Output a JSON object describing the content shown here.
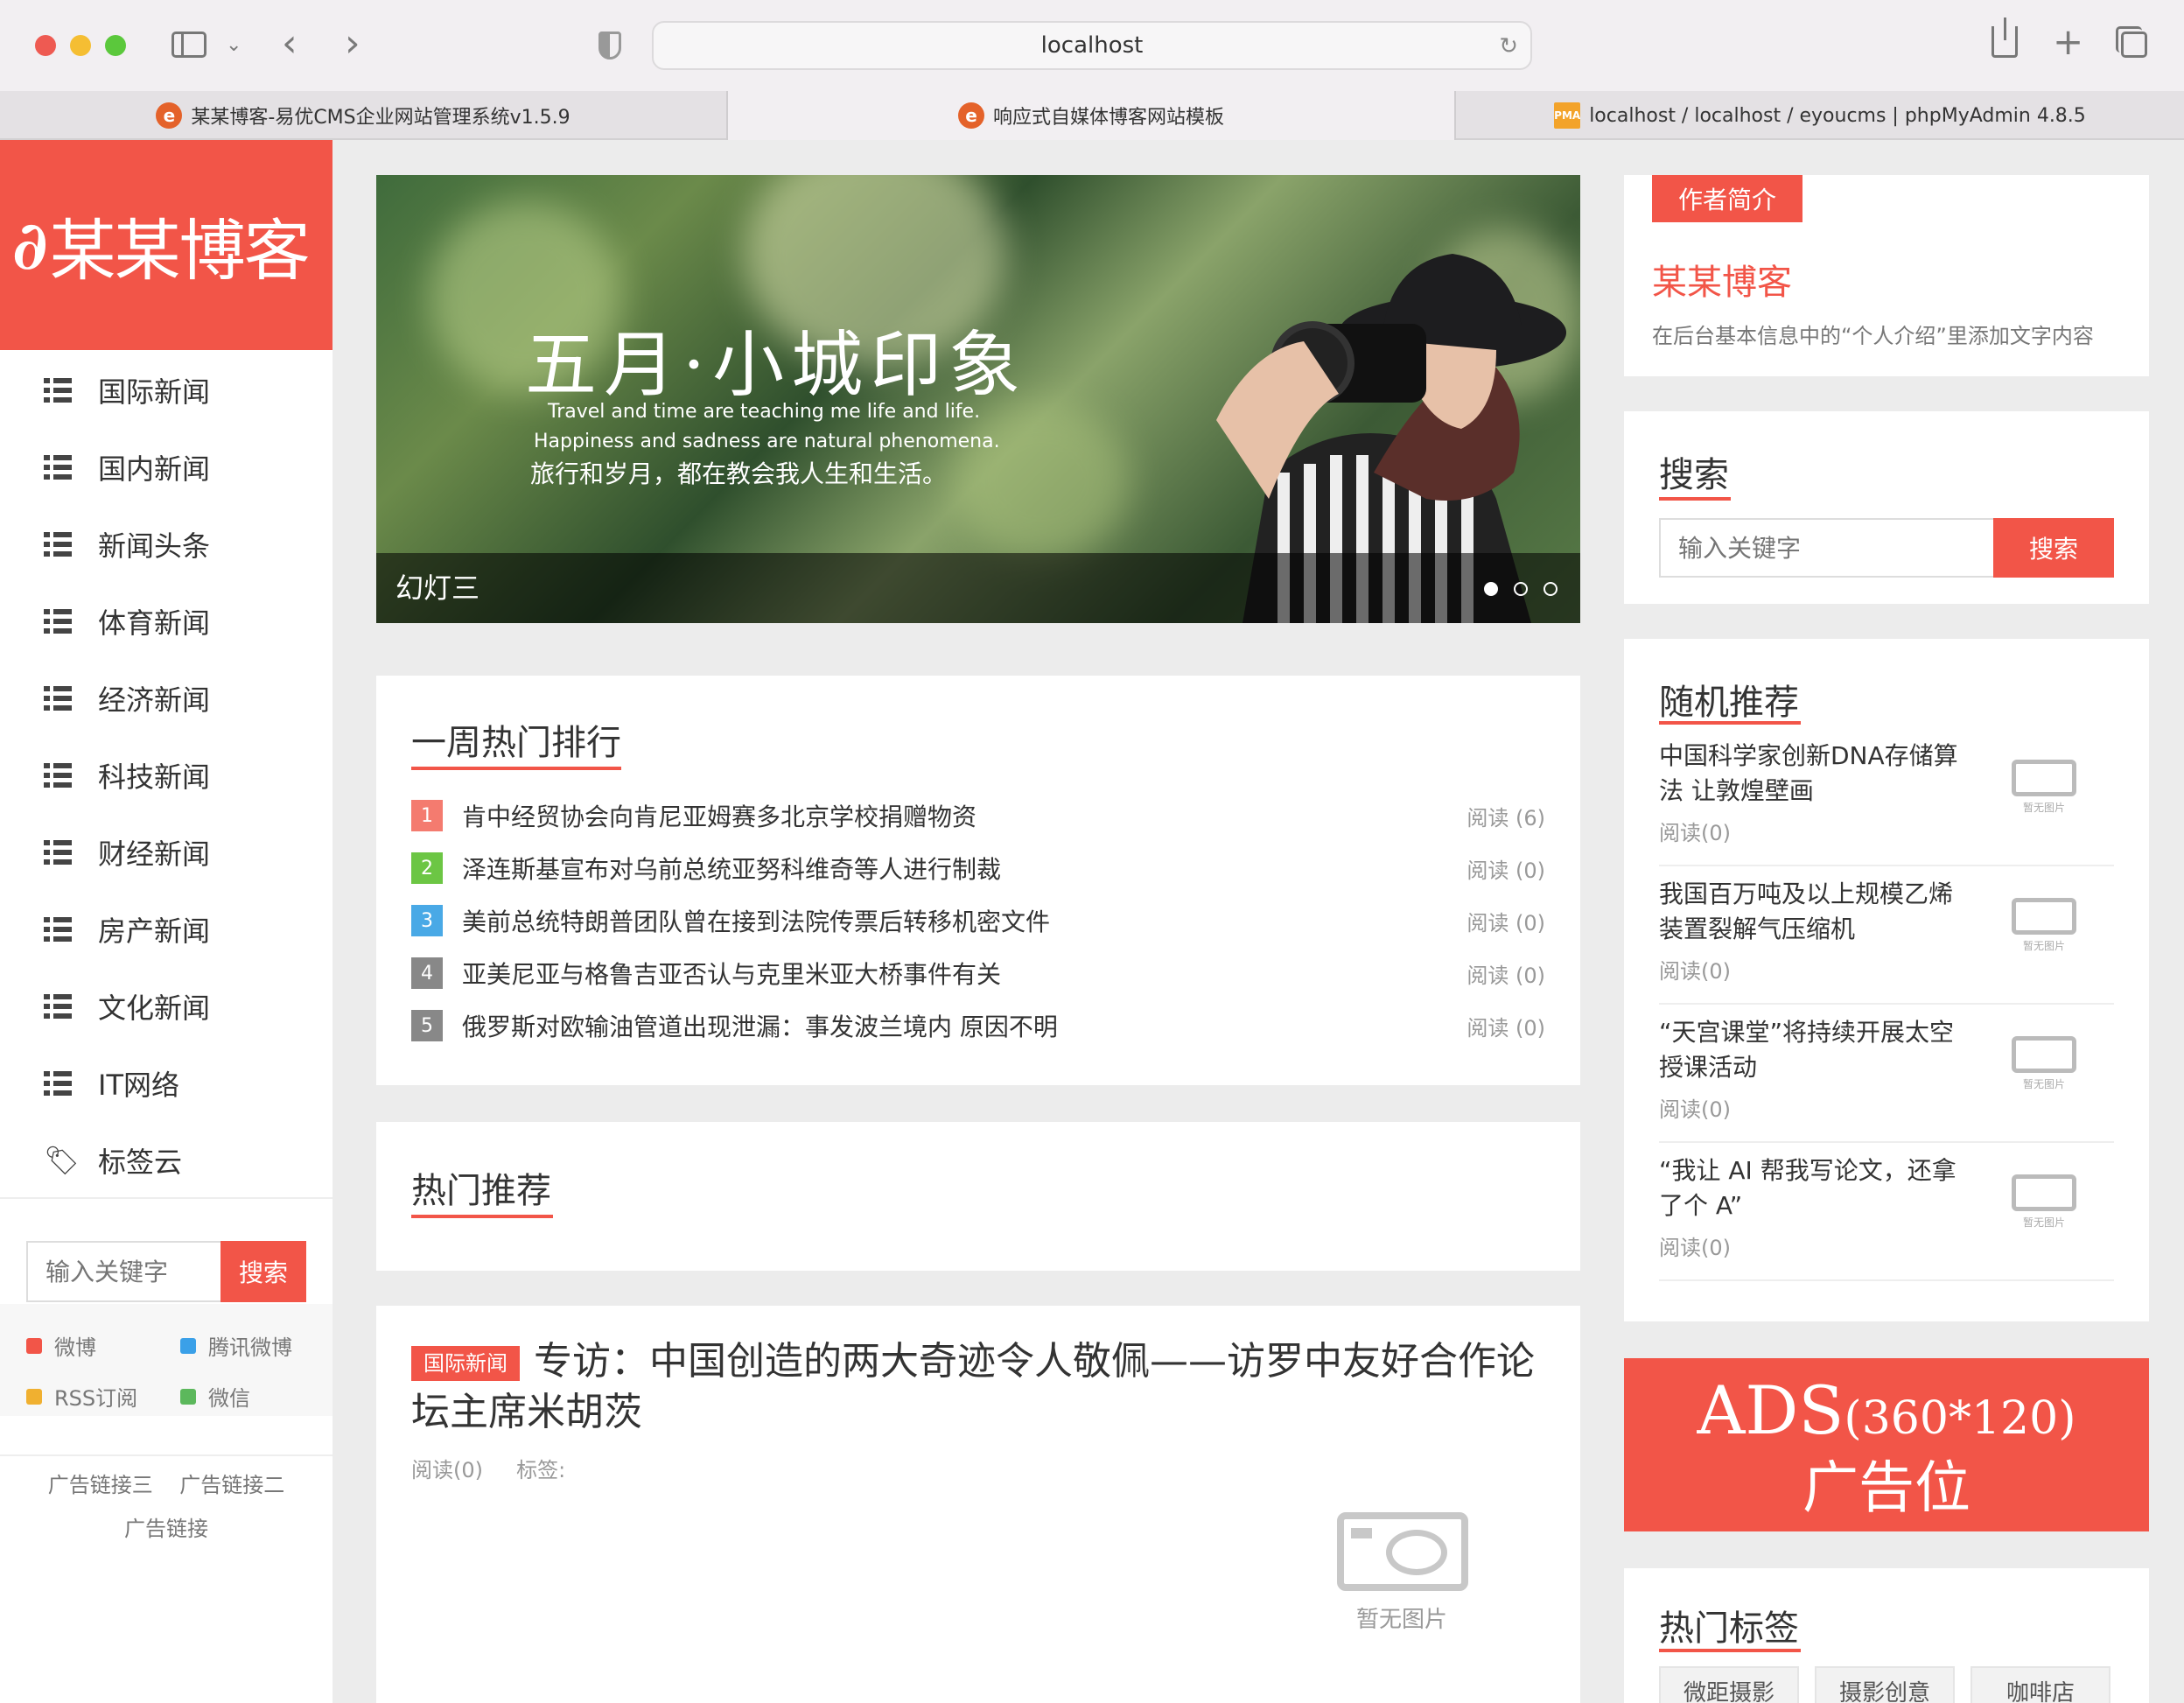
{
  "browser": {
    "address": "localhost",
    "tabs": [
      {
        "label": "某某博客-易优CMS企业网站管理系统v1.5.9"
      },
      {
        "label": "响应式自媒体博客网站模板"
      },
      {
        "label": "localhost / localhost / eyoucms | phpMyAdmin 4.8.5"
      }
    ]
  },
  "sidebar": {
    "logo_text": "某某博客",
    "nav": [
      {
        "label": "国际新闻"
      },
      {
        "label": "国内新闻"
      },
      {
        "label": "新闻头条"
      },
      {
        "label": "体育新闻"
      },
      {
        "label": "经济新闻"
      },
      {
        "label": "科技新闻"
      },
      {
        "label": "财经新闻"
      },
      {
        "label": "房产新闻"
      },
      {
        "label": "文化新闻"
      },
      {
        "label": "IT网络"
      },
      {
        "label": "标签云"
      }
    ],
    "search": {
      "placeholder": "输入关键字",
      "button": "搜索"
    },
    "social": [
      {
        "label": "微博",
        "color": "#f25548"
      },
      {
        "label": "腾讯微博",
        "color": "#3aa0e8"
      },
      {
        "label": "RSS订阅",
        "color": "#f0b030"
      },
      {
        "label": "微信",
        "color": "#5cb85c"
      }
    ],
    "ad_links": [
      "广告链接三",
      "广告链接二",
      "广告链接"
    ]
  },
  "slider": {
    "title_line": "五月·小城印象",
    "en_line1": "Travel and time are teaching me life and life.",
    "en_line2": "Happiness and sadness are natural phenomena.",
    "cn_line": "旅行和岁月，都在教会我人生和生活。",
    "caption": "幻灯三",
    "dots_total": 3,
    "active_dot": 1
  },
  "hot_week": {
    "title": "一周热门排行",
    "items": [
      {
        "num": "1",
        "title": "肯中经贸协会向肯尼亚姆赛多北京学校捐赠物资",
        "read": "阅读 (6)",
        "color": "#f47b6f"
      },
      {
        "num": "2",
        "title": "泽连斯基宣布对乌前总统亚努科维奇等人进行制裁",
        "read": "阅读 (0)",
        "color": "#6cc644"
      },
      {
        "num": "3",
        "title": "美前总统特朗普团队曾在接到法院传票后转移机密文件",
        "read": "阅读 (0)",
        "color": "#49a9e6"
      },
      {
        "num": "4",
        "title": "亚美尼亚与格鲁吉亚否认与克里米亚大桥事件有关",
        "read": "阅读 (0)",
        "color": "#888888"
      },
      {
        "num": "5",
        "title": "俄罗斯对欧输油管道出现泄漏：事发波兰境内 原因不明",
        "read": "阅读 (0)",
        "color": "#888888"
      }
    ]
  },
  "hot_recommend": {
    "title": "热门推荐"
  },
  "article": {
    "category": "国际新闻",
    "title": "专访：中国创造的两大奇迹令人敬佩——访罗中友好合作论坛主席米胡茨",
    "read": "阅读(0)",
    "tags_label": "标签:",
    "no_image": "暂无图片"
  },
  "author": {
    "badge": "作者简介",
    "name": "某某博客",
    "desc": "在后台基本信息中的“个人介绍”里添加文字内容"
  },
  "right_search": {
    "title": "搜索",
    "placeholder": "输入关键字",
    "button": "搜索"
  },
  "random": {
    "title": "随机推荐",
    "no_image": "暂无图片",
    "items": [
      {
        "title": "中国科学家创新DNA存储算法 让敦煌壁画",
        "read": "阅读(0)"
      },
      {
        "title": "我国百万吨及以上规模乙烯装置裂解气压缩机",
        "read": "阅读(0)"
      },
      {
        "title": "“天宫课堂”将持续开展太空授课活动",
        "read": "阅读(0)"
      },
      {
        "title": "“我让 AI 帮我写论文，还拿了个 A”",
        "read": "阅读(0)"
      }
    ]
  },
  "ad_banner": {
    "line1": "ADS",
    "line1_small": "(360*120)",
    "line2": "广告位"
  },
  "hot_tags": {
    "title": "热门标签",
    "tags": [
      "微距摄影",
      "摄影创意",
      "咖啡店"
    ]
  },
  "colors": {
    "accent": "#f25548"
  }
}
